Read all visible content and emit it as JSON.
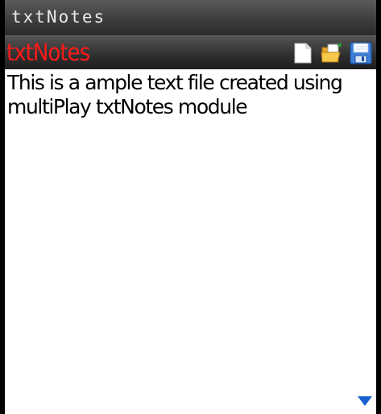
{
  "window": {
    "system_title": "txtNotes"
  },
  "app_bar": {
    "title": "txtNotes",
    "title_color": "#ff1a1a",
    "toolbar": [
      {
        "icon": "new-document-icon"
      },
      {
        "icon": "open-folder-icon"
      },
      {
        "icon": "save-disk-icon"
      }
    ]
  },
  "editor": {
    "text": "This is a ample text file created using multiPlay txtNotes module"
  },
  "scroll": {
    "icon": "scroll-down-arrow-icon",
    "color": "#1a5fd0"
  }
}
